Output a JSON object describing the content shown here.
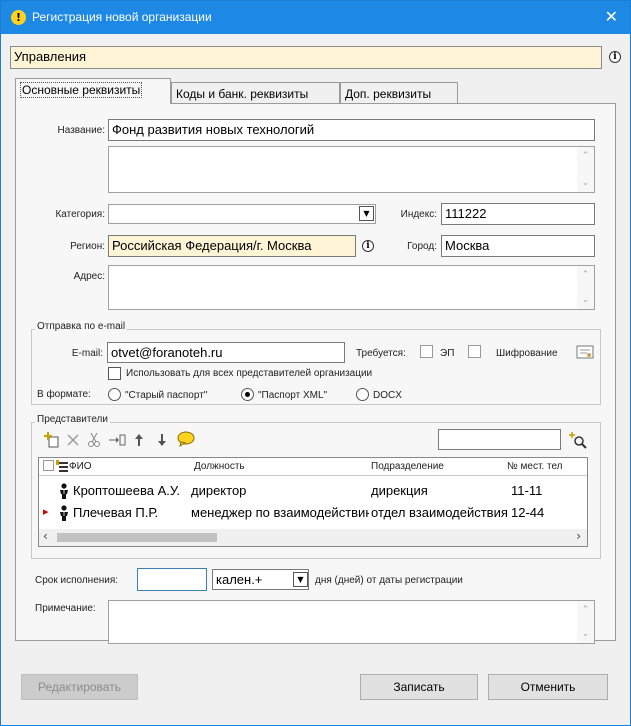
{
  "window": {
    "title": "Регистрация новой организации",
    "close_glyph": "✕",
    "title_icon_glyph": "!"
  },
  "top_field": {
    "value": "Управления",
    "info_glyph": "i"
  },
  "tabs": [
    {
      "label": "Основные реквизиты",
      "active": true
    },
    {
      "label": "Коды и банк. реквизиты",
      "active": false
    },
    {
      "label": "Доп. реквизиты",
      "active": false
    }
  ],
  "form": {
    "name_label": "Название:",
    "name_value": "Фонд развития новых технологий",
    "category_label": "Категория:",
    "category_value": "",
    "index_label": "Индекс:",
    "index_value": "111222",
    "region_label": "Регион:",
    "region_value": "Российская Федерация/г. Москва",
    "city_label": "Город:",
    "city_value": "Москва",
    "address_label": "Адрес:",
    "address_value": ""
  },
  "email_group": {
    "title": "Отправка по e-mail",
    "email_label": "E-mail:",
    "email_value": "otvet@foranoteh.ru",
    "requires_label": "Требуется:",
    "ep_label": "ЭП",
    "encrypt_label": "Шифрование",
    "use_all_label": "Использовать для всех представителей организации",
    "format_label": "В формате:",
    "formats": [
      {
        "label": "\"Старый паспорт\"",
        "selected": false
      },
      {
        "label": "\"Паспорт XML\"",
        "selected": true
      },
      {
        "label": "DOCX",
        "selected": false
      }
    ]
  },
  "representatives": {
    "title": "Представители",
    "search_value": "",
    "columns": [
      "ФИО",
      "Должность",
      "Подразделение",
      "№ мест. тел"
    ],
    "rows": [
      {
        "fio": "Кроптошеева А.У.",
        "position": "директор",
        "department": "дирекция",
        "phone": "11-11",
        "current": false
      },
      {
        "fio": "Плечевая П.Р.",
        "position": "менеджер по взаимодействию",
        "department": "отдел взаимодействия",
        "phone": "12-44",
        "current": true
      }
    ]
  },
  "deadline": {
    "label": "Срок исполнения:",
    "value": "",
    "type_value": "кален.+",
    "suffix": "дня (дней) от даты регистрации"
  },
  "note": {
    "label": "Примечание:",
    "value": ""
  },
  "buttons": {
    "edit": "Редактировать",
    "save": "Записать",
    "cancel": "Отменить"
  },
  "icons": {
    "up_glyph": "⌃",
    "down_glyph": "⌄",
    "dropdown_glyph": "▼",
    "scroll_left_glyph": "‹",
    "scroll_right_glyph": "›",
    "row_marker_glyph": "▸",
    "info_glyph": "i"
  },
  "colors": {
    "titlebar": "#1e88e5",
    "field_highlight": "#fff4d6",
    "row_marker": "#d00000"
  }
}
